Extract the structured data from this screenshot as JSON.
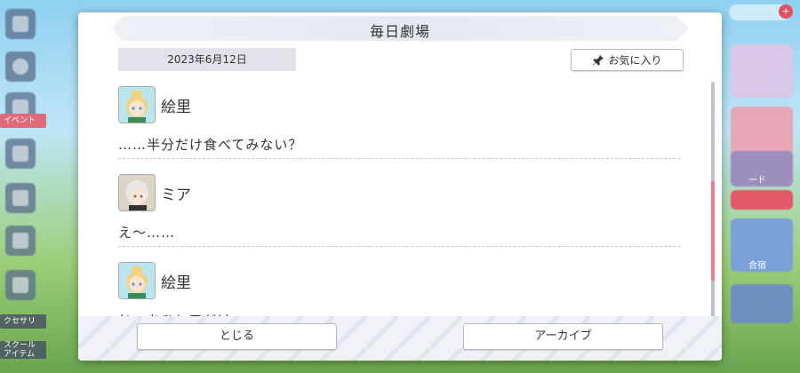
{
  "background": {
    "left_labels": [
      "イベント",
      "クセサリ",
      "スクール\nアイテム"
    ],
    "right_labels": [
      "ード",
      "合宿"
    ]
  },
  "modal": {
    "title": "毎日劇場",
    "date": "2023年6月12日",
    "favorite_label": "お気に入り",
    "entries": [
      {
        "speaker": "絵里",
        "avatar": "eri",
        "line": "……半分だけ食べてみない？"
      },
      {
        "speaker": "ミア",
        "avatar": "mia",
        "line": "え〜……"
      },
      {
        "speaker": "絵里",
        "avatar": "eri",
        "line": "じゃあひと口だけ"
      }
    ],
    "close_label": "とじる",
    "archive_label": "アーカイブ",
    "accent_color": "#f07a8a"
  }
}
